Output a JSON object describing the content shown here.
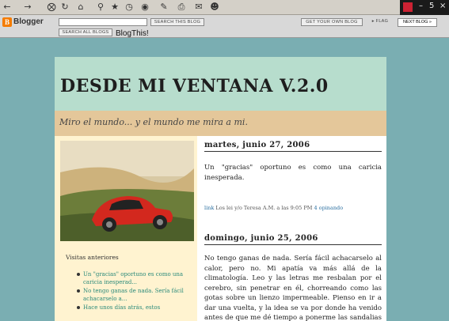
{
  "toolbar": {
    "icons": [
      "back-icon",
      "forward-icon",
      "stop-icon",
      "refresh-icon",
      "home-icon",
      "search-icon",
      "favorites-icon",
      "history-icon",
      "media-icon",
      "edit-icon",
      "print-icon",
      "discuss-icon",
      "messenger-icon"
    ]
  },
  "window": {
    "minimize": "–",
    "restore": "5",
    "close": "×"
  },
  "navbar": {
    "logo_letter": "B",
    "logo_text": "Blogger",
    "search_this_blog": "SEARCH THIS BLOG",
    "search_all_blogs": "SEARCH ALL BLOGS",
    "blog_this": "BlogThis!",
    "get_your_own": "GET YOUR OWN BLOG",
    "flag": "▸ FLAG",
    "next_blog": "NEXT BLOG »"
  },
  "blog": {
    "title": "DESDE MI VENTANA V.2.0",
    "tagline": "Miro el mundo... y el mundo me mira a mi."
  },
  "sidebar": {
    "previous_title": "Visitas anteriores",
    "previous_posts": [
      "Un \"gracias\" oportuno es como una caricia inesperad...",
      "No tengo ganas de nada. Sería fácil achacarselo a...",
      "Hace unos días atrás, estos"
    ]
  },
  "posts": [
    {
      "date": "martes, junio 27, 2006",
      "body": "Un \"gracias\" oportuno es como una caricia inesperada.",
      "meta_link": "link",
      "meta_text": "Los lei y/o Teresa A.M. a las 9:05 PM",
      "comments": "4 opinando"
    },
    {
      "date": "domingo, junio 25, 2006",
      "body": "No tengo ganas de nada. Sería fácil achacarselo al calor, pero no. Mi apatía va más allá de la climatología. Leo y las letras me resbalan por el cerebro, sin penetrar en él, chorreando como las gotas sobre un lienzo impermeable. Pienso en ir a dar una vuelta, y la idea se va por donde ha venido antes de que me dé tiempo a ponerme las sandalias y coger"
    }
  ],
  "colors": {
    "background": "#7aaeb2",
    "header_band": "#b7ddcd",
    "tagline_band": "#e4c79a",
    "sidebar": "#fff3d0",
    "link": "#2a8a7a"
  }
}
